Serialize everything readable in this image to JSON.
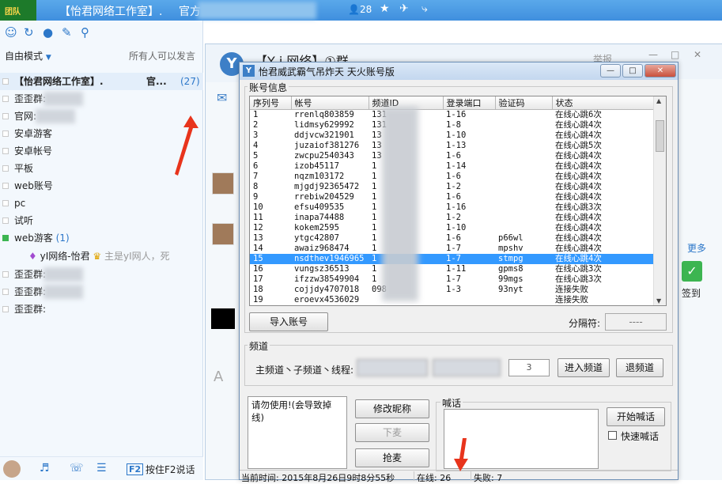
{
  "topbar": {
    "logo_text": "团队",
    "title": "【怡君网络工作室】.",
    "title2": "官方",
    "member_count": "28"
  },
  "left": {
    "mode_label": "自由模式",
    "all_can_speak": "所有人可以发言",
    "groups": [
      {
        "label": "【怡君网络工作室】.",
        "extra": "官...",
        "count": "(27)"
      },
      {
        "label": "歪歪群:"
      },
      {
        "label": "官网:"
      },
      {
        "label": "安卓游客"
      },
      {
        "label": "安卓帐号"
      },
      {
        "label": "平板"
      },
      {
        "label": "web账号"
      },
      {
        "label": "pc"
      },
      {
        "label": "试听"
      },
      {
        "label": "web游客",
        "count": "(1)"
      }
    ],
    "chat_user": "yI网络-怡君",
    "chat_msg": "主是yI网人，死",
    "groups_after": [
      {
        "label": "歪歪群:"
      },
      {
        "label": "歪歪群:"
      },
      {
        "label": "歪歪群:"
      }
    ],
    "bottom_f2": "F2",
    "bottom_text": "按住F2说话"
  },
  "bgwin": {
    "y_logo": "Y",
    "group_title": "【Y i 网络】①群",
    "report": "举报",
    "more": "更多",
    "sign": "签到"
  },
  "dialog": {
    "title": "怡君威武霸气吊炸天 天火账号版",
    "account_section": "账号信息",
    "columns": [
      "序列号",
      "帐号",
      "频道ID",
      "登录端口",
      "验证码",
      "状态"
    ],
    "rows": [
      {
        "no": "1",
        "acct": "rrenlq803859",
        "cid": "131",
        "port": "1-16",
        "code": "",
        "status": "在线心跳6次"
      },
      {
        "no": "2",
        "acct": "lidmsy629992",
        "cid": "131",
        "port": "1-8",
        "code": "",
        "status": "在线心跳4次"
      },
      {
        "no": "3",
        "acct": "ddjvcw321901",
        "cid": "13",
        "port": "1-10",
        "code": "",
        "status": "在线心跳4次"
      },
      {
        "no": "4",
        "acct": "juzaiof381276",
        "cid": "13",
        "port": "1-13",
        "code": "",
        "status": "在线心跳5次"
      },
      {
        "no": "5",
        "acct": "zwcpu2540343",
        "cid": "13",
        "port": "1-6",
        "code": "",
        "status": "在线心跳4次"
      },
      {
        "no": "6",
        "acct": "izob45117",
        "cid": "1",
        "port": "1-14",
        "code": "",
        "status": "在线心跳4次"
      },
      {
        "no": "7",
        "acct": "nqzm103172",
        "cid": "1",
        "port": "1-6",
        "code": "",
        "status": "在线心跳4次"
      },
      {
        "no": "8",
        "acct": "mjgdj92365472",
        "cid": "1",
        "port": "1-2",
        "code": "",
        "status": "在线心跳4次"
      },
      {
        "no": "9",
        "acct": "rrebiw204529",
        "cid": "1",
        "port": "1-6",
        "code": "",
        "status": "在线心跳4次"
      },
      {
        "no": "10",
        "acct": "efsu409535",
        "cid": "1",
        "port": "1-16",
        "code": "",
        "status": "在线心跳3次"
      },
      {
        "no": "11",
        "acct": "inapa74488",
        "cid": "1",
        "port": "1-2",
        "code": "",
        "status": "在线心跳4次"
      },
      {
        "no": "12",
        "acct": "kokem2595",
        "cid": "1",
        "port": "1-10",
        "code": "",
        "status": "在线心跳4次"
      },
      {
        "no": "13",
        "acct": "ytgc42807",
        "cid": "1",
        "port": "1-6",
        "code": "p66wl",
        "status": "在线心跳4次"
      },
      {
        "no": "14",
        "acct": "awaiz968474",
        "cid": "1",
        "port": "1-7",
        "code": "mpshv",
        "status": "在线心跳4次"
      },
      {
        "no": "15",
        "acct": "nsdthev1946965",
        "cid": "1",
        "port": "1-7",
        "code": "stmpg",
        "status": "在线心跳4次"
      },
      {
        "no": "16",
        "acct": "vungsz36513",
        "cid": "1",
        "port": "1-11",
        "code": "gpms8",
        "status": "在线心跳3次"
      },
      {
        "no": "17",
        "acct": "ifzzw38549904",
        "cid": "1",
        "port": "1-7",
        "code": "99mgs",
        "status": "在线心跳3次"
      },
      {
        "no": "18",
        "acct": "cojjdy4707018",
        "cid": "098",
        "port": "1-3",
        "code": "93nyt",
        "status": "连接失败"
      },
      {
        "no": "19",
        "acct": "eroevx4536029",
        "cid": "",
        "port": "",
        "code": "",
        "status": "连接失败"
      }
    ],
    "selected_row": 15,
    "import_btn": "导入账号",
    "sep_label": "分隔符:",
    "sep_value": "----",
    "channel_section": "频道",
    "channel_label": "主频道丶子频道丶线程:",
    "thread_value": "3",
    "enter_btn": "进入频道",
    "exit_btn": "退频道",
    "msg_text": "请勿使用!(会导致掉线)",
    "rename_btn": "修改昵称",
    "mic_down_btn": "下麦",
    "grab_mic_btn": "抢麦",
    "shout_section": "喊话",
    "start_shout_btn": "开始喊话",
    "fast_shout": "快速喊话",
    "status_time": "当前时间: 2015年8月26日9时8分55秒",
    "status_online": "在线: 26",
    "status_fail": "失败: 7"
  }
}
